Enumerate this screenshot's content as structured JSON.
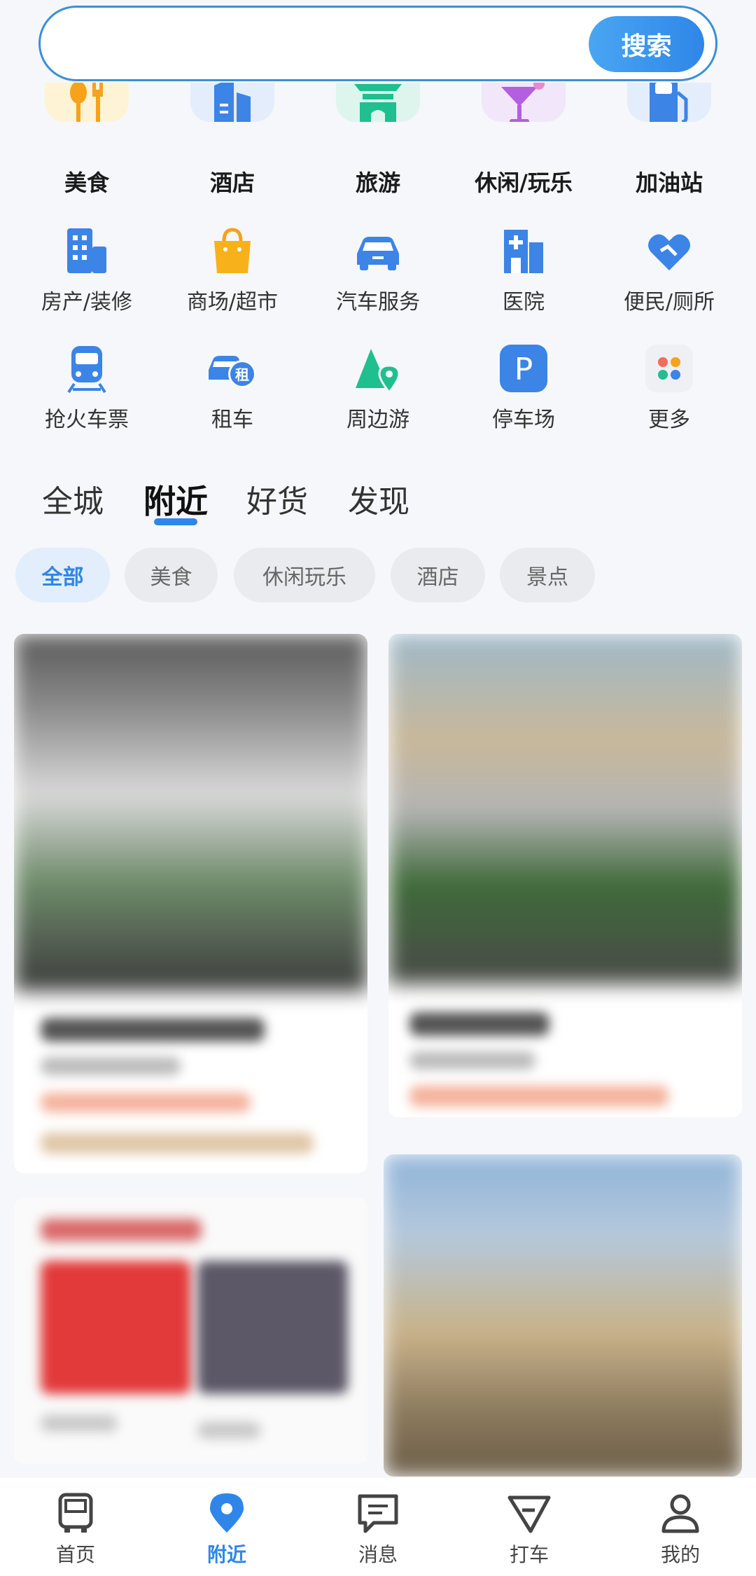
{
  "search": {
    "placeholder": "",
    "button_label": "搜索"
  },
  "top_categories": [
    {
      "label": "美食",
      "icon": "fork-spoon-icon"
    },
    {
      "label": "酒店",
      "icon": "hotel-building-icon"
    },
    {
      "label": "旅游",
      "icon": "pagoda-gate-icon"
    },
    {
      "label": "休闲/玩乐",
      "icon": "cocktail-icon"
    },
    {
      "label": "加油站",
      "icon": "fuel-pump-icon"
    }
  ],
  "grid_categories": [
    {
      "label": "房产/装修",
      "icon": "apartment-icon"
    },
    {
      "label": "商场/超市",
      "icon": "shopping-bag-icon"
    },
    {
      "label": "汽车服务",
      "icon": "car-icon"
    },
    {
      "label": "医院",
      "icon": "hospital-icon"
    },
    {
      "label": "便民/厕所",
      "icon": "handshake-heart-icon"
    },
    {
      "label": "抢火车票",
      "icon": "train-icon"
    },
    {
      "label": "租车",
      "icon": "rent-car-icon",
      "badge": "租"
    },
    {
      "label": "周边游",
      "icon": "mountain-pin-icon"
    },
    {
      "label": "停车场",
      "icon": "parking-icon",
      "badge": "P"
    },
    {
      "label": "更多",
      "icon": "more-apps-icon"
    }
  ],
  "feed_tabs": [
    {
      "label": "全城",
      "active": false
    },
    {
      "label": "附近",
      "active": true
    },
    {
      "label": "好货",
      "active": false
    },
    {
      "label": "发现",
      "active": false
    }
  ],
  "filter_chips": [
    {
      "label": "全部",
      "active": true
    },
    {
      "label": "美食",
      "active": false
    },
    {
      "label": "休闲玩乐",
      "active": false
    },
    {
      "label": "酒店",
      "active": false
    },
    {
      "label": "景点",
      "active": false
    }
  ],
  "bottom_nav": [
    {
      "label": "首页",
      "icon": "bus-icon",
      "active": false
    },
    {
      "label": "附近",
      "icon": "location-pin-icon",
      "active": true
    },
    {
      "label": "消息",
      "icon": "message-icon",
      "active": false
    },
    {
      "label": "打车",
      "icon": "taxi-arrow-icon",
      "active": false
    },
    {
      "label": "我的",
      "icon": "user-icon",
      "active": false
    }
  ],
  "colors": {
    "accent": "#2f86e8",
    "search_border": "#3a8fd8",
    "background": "#f5f7fa"
  }
}
